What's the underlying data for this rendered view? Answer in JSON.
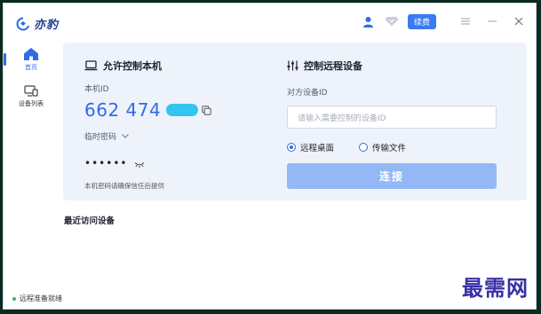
{
  "app": {
    "name": "亦豹",
    "brand_color": "#2f6be8",
    "renew_label": "续费"
  },
  "window_controls": {
    "menu_icon": "hamburger-icon",
    "minimize_icon": "minimize-icon",
    "close_icon": "close-icon"
  },
  "sidebar": {
    "items": [
      {
        "label": "首页",
        "icon": "home-icon",
        "active": true
      },
      {
        "label": "设备列表",
        "icon": "device-list-icon",
        "active": false
      }
    ]
  },
  "local": {
    "title": "允许控制本机",
    "id_label": "本机ID",
    "id_value": "662 474",
    "password_label": "临时密码",
    "password_value": "••••••",
    "hint": "本机密码请确保信任后提供"
  },
  "remote": {
    "title": "控制远程设备",
    "peer_label": "对方设备ID",
    "peer_placeholder": "请输入需要控制的设备ID",
    "options": [
      {
        "label": "远程桌面",
        "checked": true
      },
      {
        "label": "传输文件",
        "checked": false
      }
    ],
    "connect_label": "连接"
  },
  "recent": {
    "title": "最近访问设备"
  },
  "status": {
    "text": "远程准备就绪",
    "color": "#2fbf5a"
  },
  "watermark": "最需网"
}
